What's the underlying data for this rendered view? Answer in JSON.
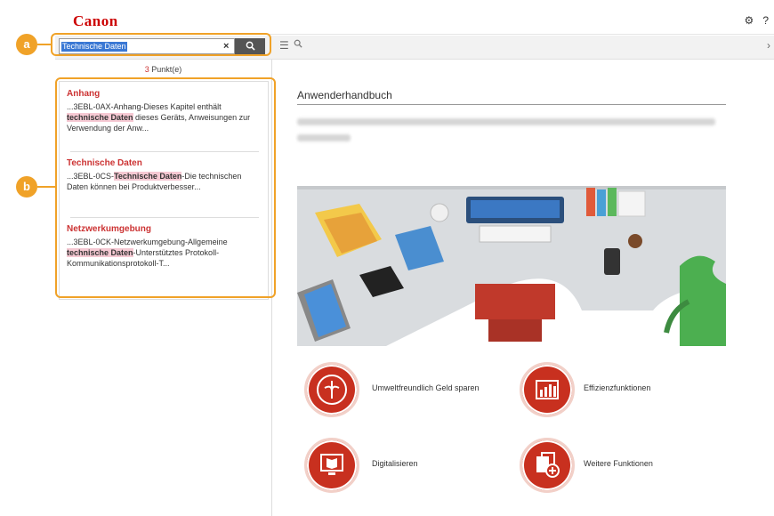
{
  "header": {
    "logo": "Canon",
    "gear_icon": "gear-icon",
    "help_icon": "help-icon"
  },
  "search": {
    "value": "Technische Daten",
    "clear": "×",
    "submit_icon": "search-icon"
  },
  "toolbar": {
    "menu_icon": "☰",
    "search_icon": "⚲",
    "next_icon": "›"
  },
  "results": {
    "count_num": "3",
    "count_label": " Punkt(e)",
    "items": [
      {
        "title": "Anhang",
        "pre": "...3EBL-0AX-Anhang-Dieses Kapitel enthält ",
        "hl": "technische Daten",
        "post": " dieses Geräts, Anweisungen zur Verwendung der Anw..."
      },
      {
        "title": "Technische Daten",
        "pre": "...3EBL-0CS-",
        "hl": "Technische Daten",
        "post": "-Die technischen Daten können bei Produktverbesser..."
      },
      {
        "title": "Netzwerkumgebung",
        "pre": "...3EBL-0CK-Netzwerkumgebung-Allgemeine ",
        "hl": "technische Daten",
        "post": "-Unterstütztes Protokoll-Kommunikationsprotokoll-T..."
      }
    ]
  },
  "main": {
    "title": "Anwenderhandbuch",
    "functions": [
      {
        "label": "Umweltfreundlich Geld sparen",
        "icon": "leaf-icon"
      },
      {
        "label": "Effizienzfunktionen",
        "icon": "chart-icon"
      },
      {
        "label": "Digitalisieren",
        "icon": "monitor-book-icon"
      },
      {
        "label": "Weitere Funktionen",
        "icon": "documents-plus-icon"
      }
    ]
  },
  "callouts": {
    "a": "a",
    "b": "b"
  },
  "colors": {
    "brand": "#cc0000",
    "accent": "#f0a228",
    "function": "#c8301f",
    "highlight": "#f6c9d3"
  }
}
